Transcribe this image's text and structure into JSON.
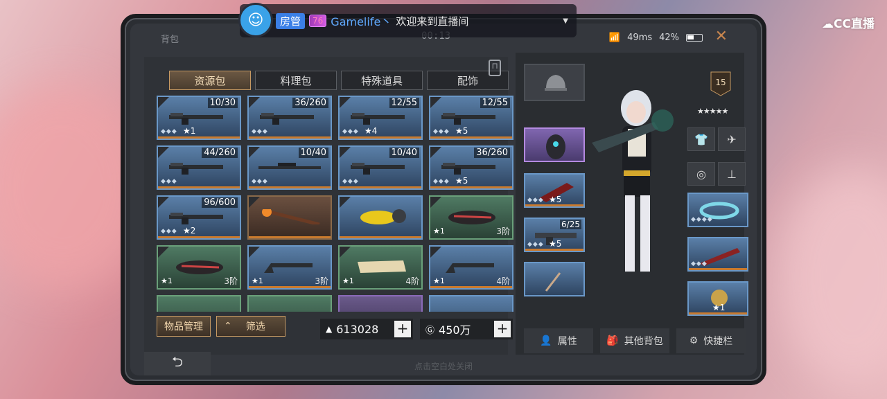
{
  "live": {
    "room_badge": "房管",
    "level": "76",
    "username": "Gamelife丶",
    "message": "欢迎来到直播间",
    "platform": "CC直播"
  },
  "header": {
    "title": "背包",
    "timer": "00:13",
    "ping": "49ms",
    "battery": "42%",
    "close": "✕"
  },
  "tabs": [
    {
      "label": "资源包",
      "active": true
    },
    {
      "label": "料理包",
      "active": false
    },
    {
      "label": "特殊道具",
      "active": false
    },
    {
      "label": "配饰",
      "active": false
    }
  ],
  "inventory": [
    {
      "count": "10/30",
      "type": "rifle",
      "level": "1",
      "color": "blue"
    },
    {
      "count": "36/260",
      "type": "rifle",
      "level": "",
      "color": "blue"
    },
    {
      "count": "12/55",
      "type": "rifle",
      "level": "4",
      "color": "blue"
    },
    {
      "count": "12/55",
      "type": "rifle",
      "level": "5",
      "color": "blue"
    },
    {
      "count": "44/260",
      "type": "rifle",
      "level": "",
      "color": "blue"
    },
    {
      "count": "10/40",
      "type": "sniper",
      "level": "",
      "color": "blue"
    },
    {
      "count": "10/40",
      "type": "rifle",
      "level": "",
      "color": "blue"
    },
    {
      "count": "36/260",
      "type": "rifle",
      "level": "5",
      "color": "blue"
    },
    {
      "count": "96/600",
      "type": "rifle",
      "level": "2",
      "color": "blue"
    },
    {
      "count": "",
      "type": "torch",
      "level": "",
      "color": "brown"
    },
    {
      "count": "",
      "type": "helmet-yellow",
      "level": "",
      "color": "blue"
    },
    {
      "count": "",
      "type": "helmet",
      "level": "1",
      "tier": "3阶",
      "color": "green"
    },
    {
      "count": "",
      "type": "helmet",
      "level": "1",
      "tier": "3阶",
      "color": "green"
    },
    {
      "count": "",
      "type": "stock",
      "level": "1",
      "tier": "3阶",
      "color": "blue"
    },
    {
      "count": "",
      "type": "scroll",
      "level": "1",
      "tier": "4阶",
      "color": "green"
    },
    {
      "count": "",
      "type": "stock",
      "level": "1",
      "tier": "4阶",
      "color": "blue"
    }
  ],
  "actions": {
    "manage": "物品管理",
    "filter": "筛选"
  },
  "currency": {
    "gold": "613028",
    "coins": "450万"
  },
  "equipment": {
    "level": "15",
    "slots": {
      "ammo_count": "6/25",
      "weapon1_level": "5",
      "weapon2_level": "5",
      "ornament_level": "1"
    }
  },
  "panel_buttons": {
    "attributes": "属性",
    "other_bags": "其他背包",
    "hotbar": "快捷栏"
  },
  "footer": {
    "back": "⮌",
    "hint": "点击空白处关闭"
  }
}
